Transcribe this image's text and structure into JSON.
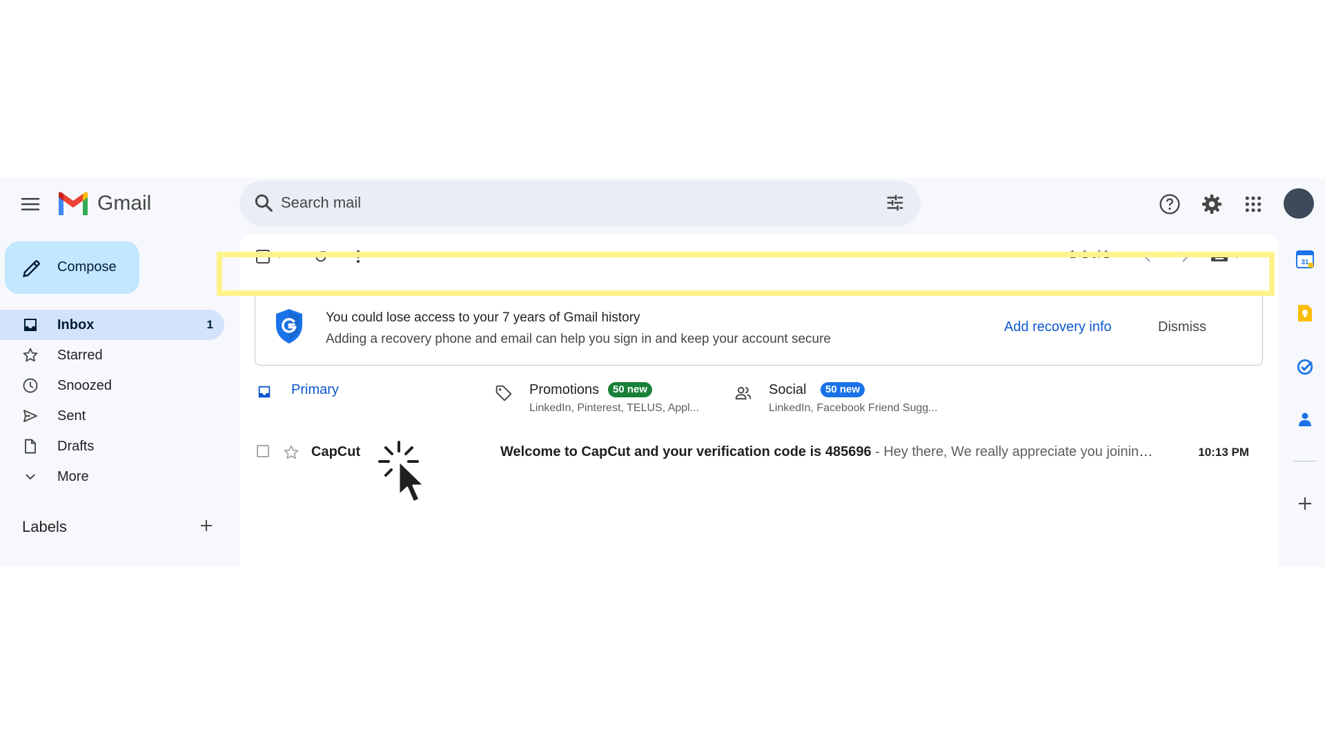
{
  "header": {
    "brand": "Gmail",
    "search_placeholder": "Search mail"
  },
  "sidebar": {
    "compose_label": "Compose",
    "items": [
      {
        "label": "Inbox",
        "count": "1",
        "icon": "inbox-icon"
      },
      {
        "label": "Starred",
        "icon": "star-icon"
      },
      {
        "label": "Snoozed",
        "icon": "clock-icon"
      },
      {
        "label": "Sent",
        "icon": "send-icon"
      },
      {
        "label": "Drafts",
        "icon": "draft-icon"
      },
      {
        "label": "More",
        "icon": "chevron-down-icon"
      }
    ],
    "labels_title": "Labels"
  },
  "toolbar": {
    "pager": "1–1 of 1"
  },
  "banner": {
    "title": "You could lose access to your 7 years of Gmail history",
    "subtitle": "Adding a recovery phone and email can help you sign in and keep your account secure",
    "action": "Add recovery info",
    "dismiss": "Dismiss"
  },
  "tabs": [
    {
      "label": "Primary"
    },
    {
      "label": "Promotions",
      "badge": "50 new",
      "sub": "LinkedIn, Pinterest, TELUS, Appl..."
    },
    {
      "label": "Social",
      "badge": "50 new",
      "sub": "LinkedIn, Facebook Friend Sugg..."
    }
  ],
  "emails": [
    {
      "sender": "CapCut",
      "subject": "Welcome to CapCut and your verification code is 485696",
      "snippet": " - Hey there, We really appreciate you joining u...",
      "time": "10:13 PM"
    }
  ],
  "colors": {
    "accent": "#0b57d0",
    "compose_bg": "#c2e7ff",
    "active_nav": "#d3e3fd",
    "promotions_badge": "#188038",
    "social_badge": "#1a73e8",
    "highlight": "#fdf38a"
  }
}
